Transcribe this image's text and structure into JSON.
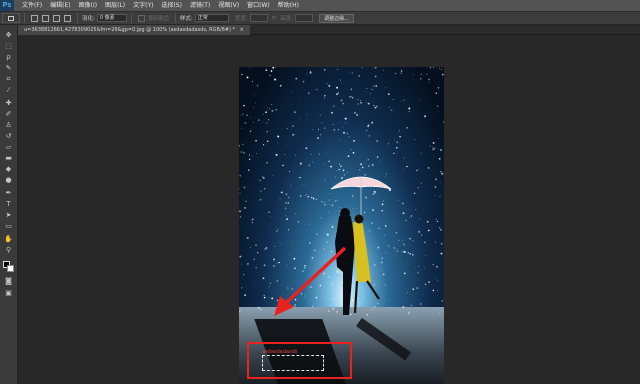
{
  "app": {
    "logo": "Ps",
    "menus": [
      "文件(F)",
      "编辑(E)",
      "图像(I)",
      "图层(L)",
      "文字(Y)",
      "选择(S)",
      "滤镜(T)",
      "视图(V)",
      "窗口(W)",
      "帮助(H)"
    ]
  },
  "options_bar": {
    "feather_label": "羽化:",
    "feather_value": "0 像素",
    "antialias_label": "消除锯齿",
    "style_label": "样式:",
    "style_value": "正常",
    "width_label": "宽度:",
    "height_label": "高度:",
    "refine_button": "调整边缘..."
  },
  "document": {
    "tab_title": "u=3638812661,4278309025&fm=26&gp=0.jpg @ 100% (asdasdadasds, RGB/8#) *",
    "tab_close": "×"
  },
  "annotation": {
    "text": "asdasdadasds",
    "color": "#e8231f"
  },
  "colors": {
    "menubar": "#535353",
    "optbar": "#3c3c3c",
    "toolbar": "#3a3a3a",
    "workspace": "#282828",
    "accent_red": "#e8231f"
  }
}
